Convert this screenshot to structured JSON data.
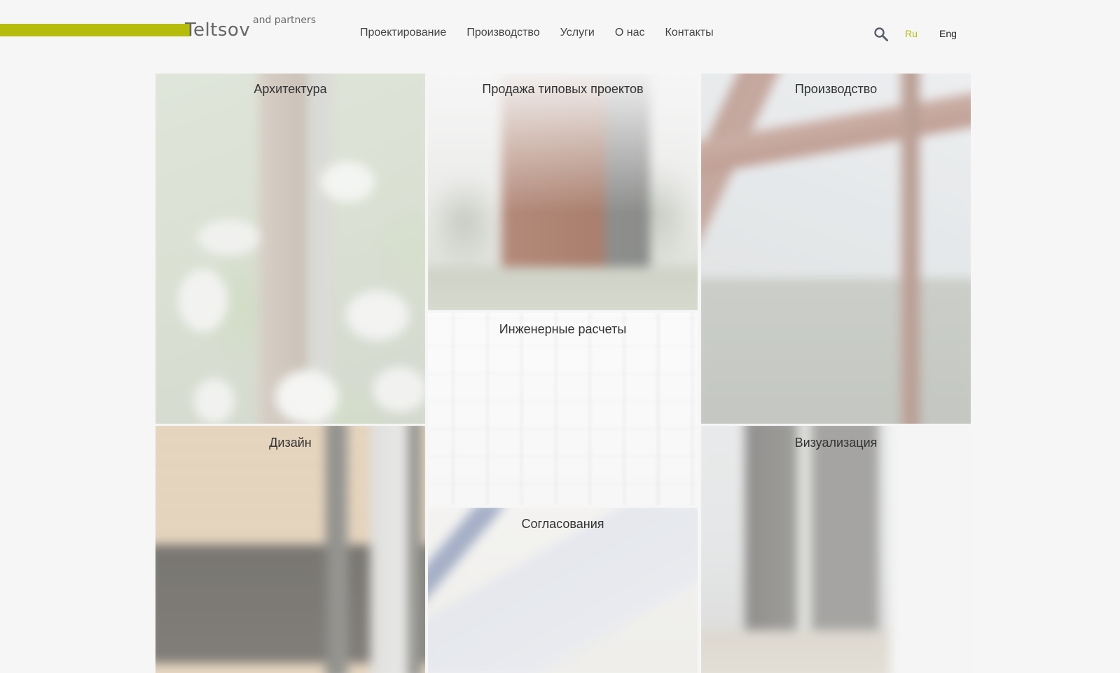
{
  "colors": {
    "accent": "#b6bc0b",
    "background": "#f6f6f6",
    "text": "#3a3a3a"
  },
  "logo": {
    "name": "Teltsov",
    "suffix": "and partners"
  },
  "nav": {
    "items": [
      "Проектирование",
      "Производство",
      "Услуги",
      "О нас",
      "Контакты"
    ]
  },
  "header": {
    "search_icon": "search-icon",
    "lang_ru": "Ru",
    "lang_en": "Eng",
    "active_lang": "Ru"
  },
  "tiles": {
    "architecture": "Архитектура",
    "typical_projects": "Продажа типовых проектов",
    "production": "Производство",
    "engineering": "Инженерные расчеты",
    "design": "Дизайн",
    "approvals": "Согласования",
    "visualization": "Визуализация"
  }
}
